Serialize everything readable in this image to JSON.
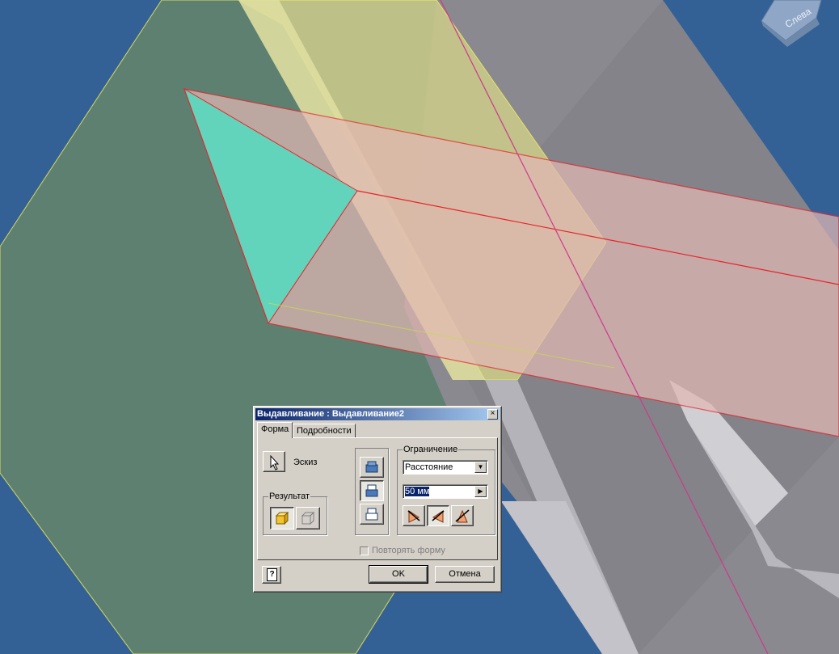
{
  "viewcube": {
    "label": "Слева"
  },
  "dialog": {
    "title": "Выдавливание : Выдавливание2",
    "close_glyph": "×",
    "tabs": [
      "Форма",
      "Подробности"
    ],
    "sketch_label": "Эскиз",
    "result_group_label": "Результат",
    "extent_group_label": "Ограничение",
    "extent_type": "Расстояние",
    "distance_value": "50 мм",
    "repeat_shape_label": "Повторять форму",
    "ok_label": "OK",
    "cancel_label": "Отмена",
    "help_glyph": "?"
  },
  "colors": {
    "background": "#336196",
    "ground_plane": "#5e8070",
    "yellow_plane": "#c9c98a",
    "grey_body": "#8a898f",
    "cyan_profile": "#62d4bc",
    "preview_extrusion": "#e0b8b0",
    "preview_edge": "#e8242a",
    "selection_blue": "#0a246a"
  }
}
